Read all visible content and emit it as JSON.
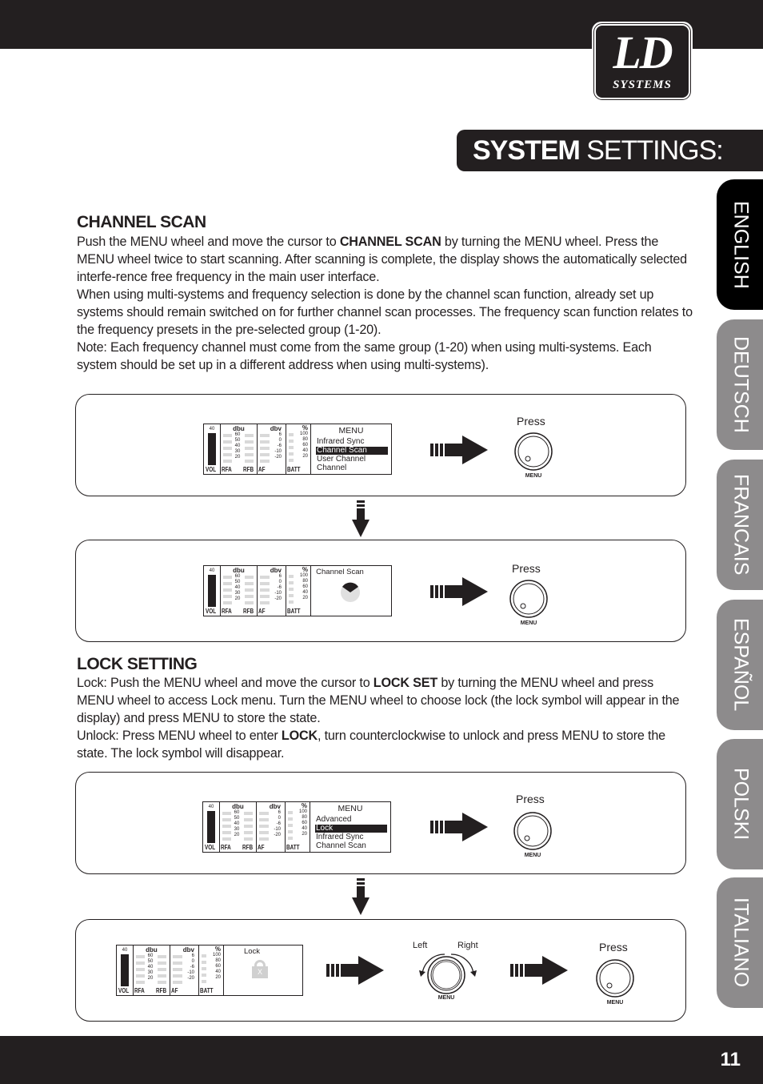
{
  "header": {
    "logo_main": "LD",
    "logo_sub": "SYSTEMS",
    "title_bold": "SYSTEM",
    "title_rest": " SETTINGS:"
  },
  "language_tabs": [
    {
      "label": "ENGLISH",
      "active": true
    },
    {
      "label": "DEUTSCH",
      "active": false
    },
    {
      "label": "FRANCAIS",
      "active": false
    },
    {
      "label": "ESPAÑOL",
      "active": false
    },
    {
      "label": "POLSKI",
      "active": false
    },
    {
      "label": "ITALIANO",
      "active": false
    }
  ],
  "channel_scan": {
    "heading": "CHANNEL SCAN",
    "p1_a": "Push the MENU wheel and move the cursor to ",
    "p1_b": "CHANNEL SCAN",
    "p1_c": " by turning the MENU wheel. Press the MENU wheel twice to start scanning. After scanning is complete, the display shows the automatically selected interfe-rence free frequency in the main user interface.",
    "p2": "When using multi-systems and frequency selection is done by the channel scan function, already set up systems should remain switched on for further channel scan processes. The frequency scan function relates to the frequency presets in the pre-selected group (1-20).",
    "p3": "Note: Each frequency channel must come from the same group (1-20) when using multi-systems. Each system should be set up in a different address when using multi-systems)."
  },
  "lock_setting": {
    "heading": "LOCK SETTING",
    "p1_a": "Lock: Push the MENU wheel and move the cursor to ",
    "p1_b": "LOCK SET",
    "p1_c": " by turning the MENU wheel and press MENU wheel to access Lock menu. Turn the MENU wheel to choose lock (the lock symbol will appear in the display) and press MENU to store the state.",
    "p2_a": "Unlock: Press MENU wheel to enter ",
    "p2_b": "LOCK",
    "p2_c": ", turn counterclockwise to unlock and press MENU to store the state. The lock symbol will disappear."
  },
  "lcd_common": {
    "vol_top": "40",
    "vol": "VOL",
    "dbu": "dbu",
    "dbu_scale": [
      "60",
      "50",
      "40",
      "30",
      "20"
    ],
    "rfa": "RFA",
    "rfb": "RFB",
    "dbv": "dbv",
    "dbv_scale": [
      "6",
      "0",
      "-6",
      "-10",
      "-20"
    ],
    "af": "AF",
    "pct": "%",
    "pct_scale": [
      "100",
      "80",
      "60",
      "40",
      "20"
    ],
    "batt": "BATT"
  },
  "displays": {
    "d1": {
      "title": "MENU",
      "items": [
        "Infrared Sync",
        "Channel Scan",
        "User Channel",
        "Channel"
      ],
      "selected": 1
    },
    "d2": {
      "title": "Channel Scan"
    },
    "d3": {
      "title": "MENU",
      "items": [
        "Advanced",
        "Lock",
        "Infrared Sync",
        "Channel Scan"
      ],
      "selected": 1
    },
    "d4": {
      "title": "Lock",
      "lock_mark": "X"
    }
  },
  "knobs": {
    "press": "Press",
    "menu": "MENU",
    "left": "Left",
    "right": "Right"
  },
  "footer": {
    "page_number": "11"
  }
}
